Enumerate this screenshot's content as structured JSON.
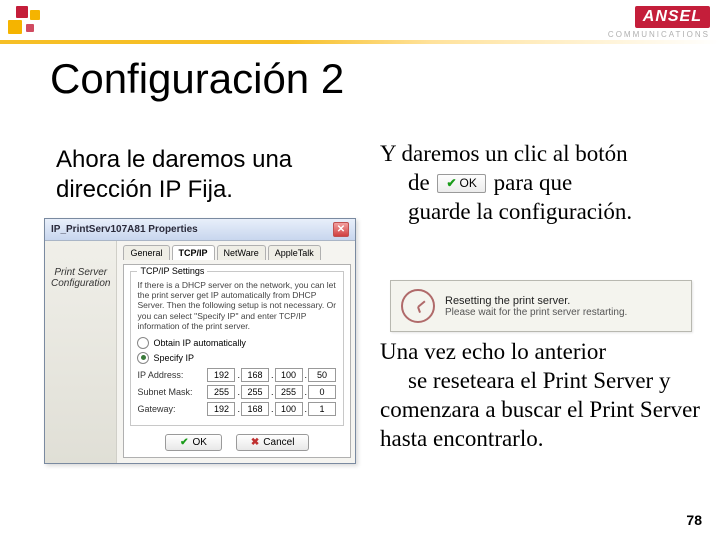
{
  "header": {
    "brand": "ANSEL",
    "brand_sub": "COMMUNICATIONS"
  },
  "slide": {
    "title": "Configuración 2",
    "page_number": "78"
  },
  "left_text": "Ahora le daremos una dirección IP Fija.",
  "right_text1_a": "Y daremos un clic al botón",
  "right_text1_b": "de",
  "right_text1_c": "para que",
  "right_text1_d": "guarde la configuración.",
  "right_text2_a": "Una vez echo lo anterior",
  "right_text2_b": "se reseteara el Print Server y comenzara a buscar el Print Server hasta encontrarlo.",
  "ok_button_inline": {
    "label": "OK"
  },
  "dialog": {
    "title": "IP_PrintServ107A81 Properties",
    "sidebar_label": "Print Server Configuration",
    "tabs": [
      "General",
      "TCP/IP",
      "NetWare",
      "AppleTalk"
    ],
    "active_tab": 1,
    "group_label": "TCP/IP Settings",
    "group_desc": "If there is a DHCP server on the network, you can let the print server get IP automatically from DHCP Server. Then the following setup is not necessary. Or you can select \"Specify IP\" and enter TCP/IP information of the print server.",
    "radio_auto": "Obtain IP automatically",
    "radio_manual": "Specify IP",
    "fields": {
      "ip_label": "IP Address:",
      "ip": [
        "192",
        "168",
        "100",
        "50"
      ],
      "mask_label": "Subnet Mask:",
      "mask": [
        "255",
        "255",
        "255",
        "0"
      ],
      "gw_label": "Gateway:",
      "gw": [
        "192",
        "168",
        "100",
        "1"
      ]
    },
    "ok": "OK",
    "cancel": "Cancel"
  },
  "reset_box": {
    "line1": "Resetting the print server.",
    "line2": "Please wait for the print server restarting."
  }
}
